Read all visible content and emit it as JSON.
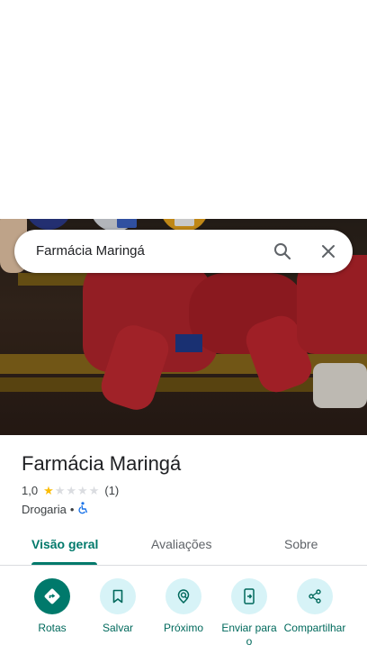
{
  "search": {
    "query": "Farmácia Maringá",
    "icons": [
      "search-icon",
      "close-icon"
    ]
  },
  "place": {
    "name": "Farmácia Maringá",
    "rating": "1,0",
    "rating_value": 1,
    "rating_max": 5,
    "review_count": "(1)",
    "category": "Drogaria",
    "separator": "•",
    "accessibility_icon": "wheelchair-icon"
  },
  "tabs": [
    {
      "label": "Visão geral",
      "active": true
    },
    {
      "label": "Avaliações",
      "active": false
    },
    {
      "label": "Sobre",
      "active": false
    }
  ],
  "actions": [
    {
      "label": "Rotas",
      "icon": "directions-icon"
    },
    {
      "label": "Salvar",
      "icon": "bookmark-icon"
    },
    {
      "label": "Próximo",
      "icon": "nearby-icon"
    },
    {
      "label": "Enviar para o",
      "icon": "send-to-phone-icon"
    },
    {
      "label": "Compartilhar",
      "icon": "share-icon"
    }
  ],
  "colors": {
    "accent": "#00796b",
    "action_bg": "#d7f3f7",
    "star_filled": "#fbbc04",
    "star_empty": "#dadce0",
    "accessibility": "#1a73e8"
  }
}
